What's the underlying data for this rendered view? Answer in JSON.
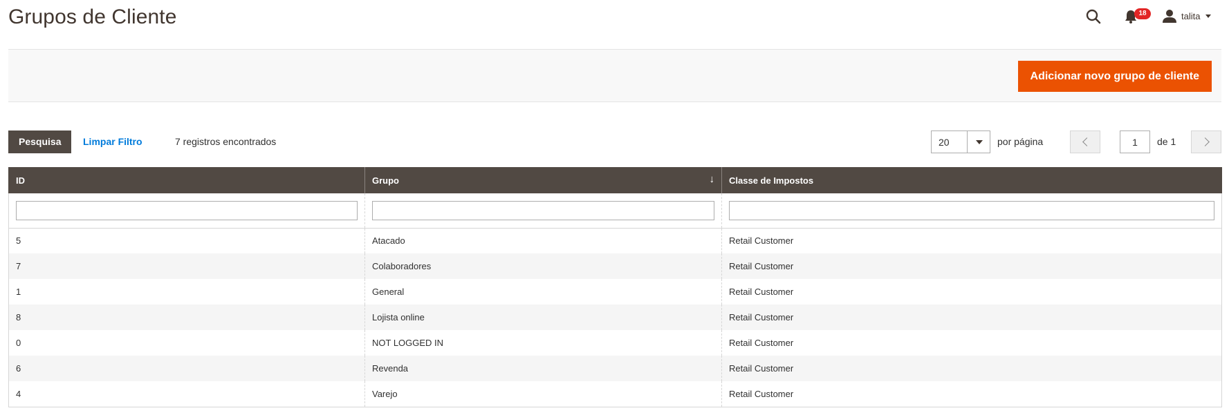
{
  "page": {
    "title": "Grupos de Cliente"
  },
  "header": {
    "notifications_count": "18",
    "user_name": "talita",
    "icons": [
      "search-icon",
      "bell-icon",
      "user-icon"
    ]
  },
  "action_bar": {
    "add_button_label": "Adicionar novo grupo de cliente",
    "accent_color": "#eb5202"
  },
  "toolbar": {
    "search_label": "Pesquisa",
    "reset_label": "Limpar Filtro",
    "records_found": "7 registros encontrados"
  },
  "pager": {
    "limit": "20",
    "per_page_label": "por página",
    "current_page": "1",
    "total_label": "de 1"
  },
  "grid": {
    "columns": [
      "ID",
      "Grupo",
      "Classe de Impostos"
    ],
    "sorted_column": "Grupo",
    "sort_direction": "down",
    "rows": [
      {
        "id": "5",
        "group": "Atacado",
        "tax_class": "Retail Customer"
      },
      {
        "id": "7",
        "group": "Colaboradores",
        "tax_class": "Retail Customer"
      },
      {
        "id": "1",
        "group": "General",
        "tax_class": "Retail Customer"
      },
      {
        "id": "8",
        "group": "Lojista online",
        "tax_class": "Retail Customer"
      },
      {
        "id": "0",
        "group": "NOT LOGGED IN",
        "tax_class": "Retail Customer"
      },
      {
        "id": "6",
        "group": "Revenda",
        "tax_class": "Retail Customer"
      },
      {
        "id": "4",
        "group": "Varejo",
        "tax_class": "Retail Customer"
      }
    ]
  },
  "colors": {
    "header_bg": "#514943",
    "link": "#007bdb",
    "badge": "#e22626"
  }
}
